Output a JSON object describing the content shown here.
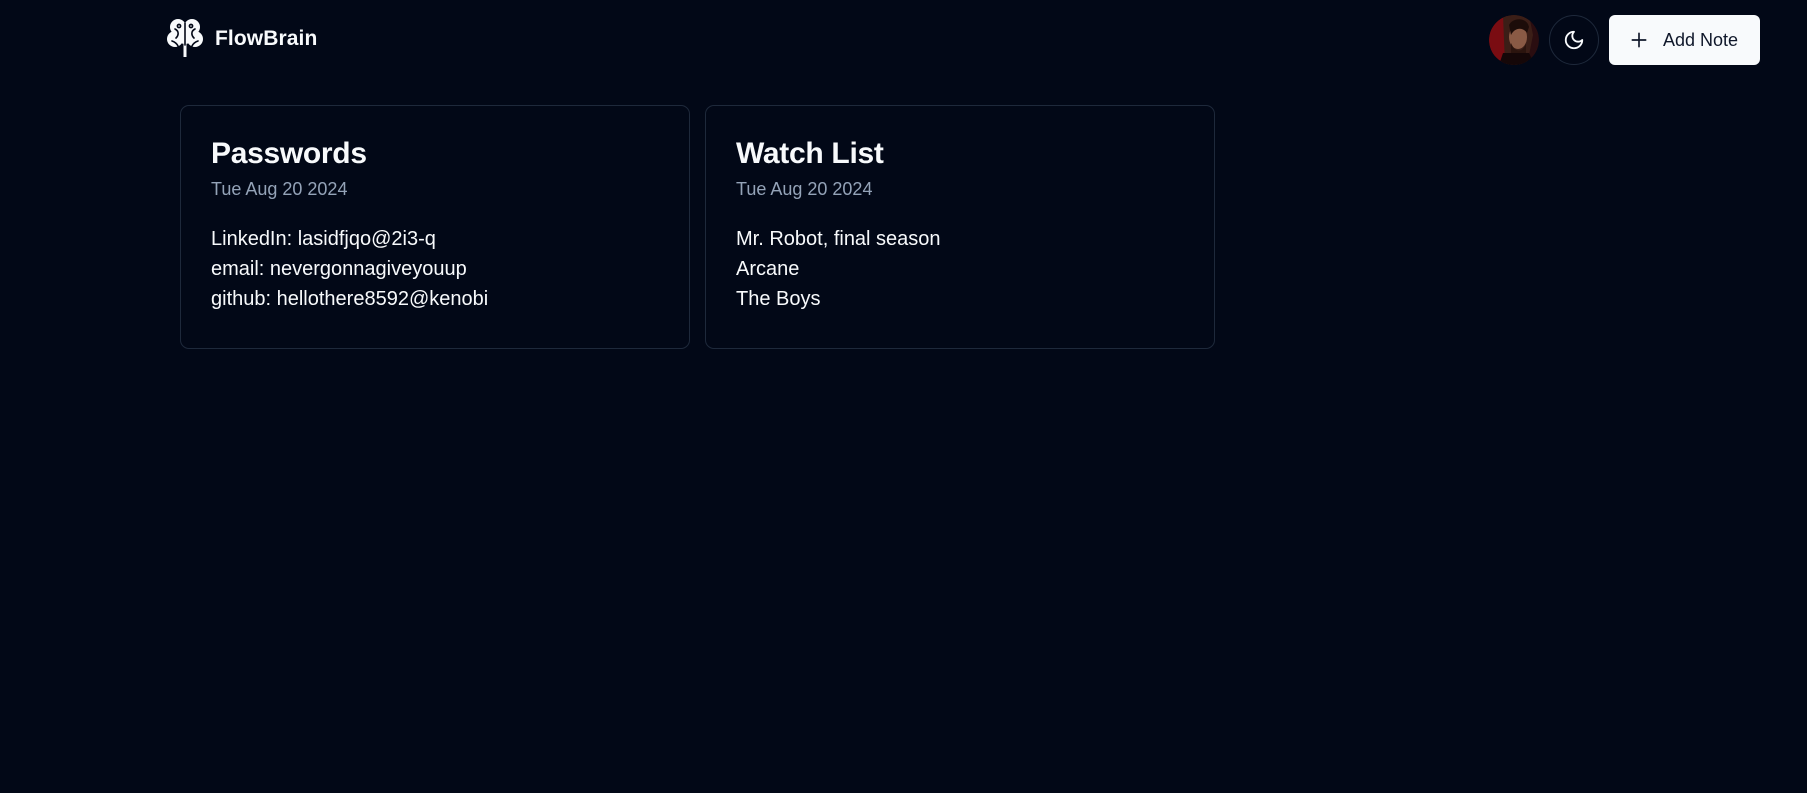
{
  "brand": {
    "name": "FlowBrain",
    "logo_icon": "brain-icon"
  },
  "header": {
    "avatar_icon": "user-avatar",
    "theme_toggle_icon": "moon-icon",
    "add_note_label": "Add Note",
    "add_note_icon": "plus-icon"
  },
  "colors": {
    "background": "#020817",
    "card_border": "#1e293b",
    "text_primary": "#f8fafc",
    "text_muted": "#94a3b8",
    "button_bg": "#f8fafc",
    "button_text": "#0f172a"
  },
  "notes": [
    {
      "title": "Passwords",
      "date": "Tue Aug 20 2024",
      "lines": [
        "LinkedIn: lasidfjqo@2i3-q",
        "email: nevergonnagiveyouup",
        "github: hellothere8592@kenobi"
      ]
    },
    {
      "title": "Watch List",
      "date": "Tue Aug 20 2024",
      "lines": [
        "Mr. Robot, final season",
        "Arcane",
        "The Boys"
      ]
    }
  ]
}
